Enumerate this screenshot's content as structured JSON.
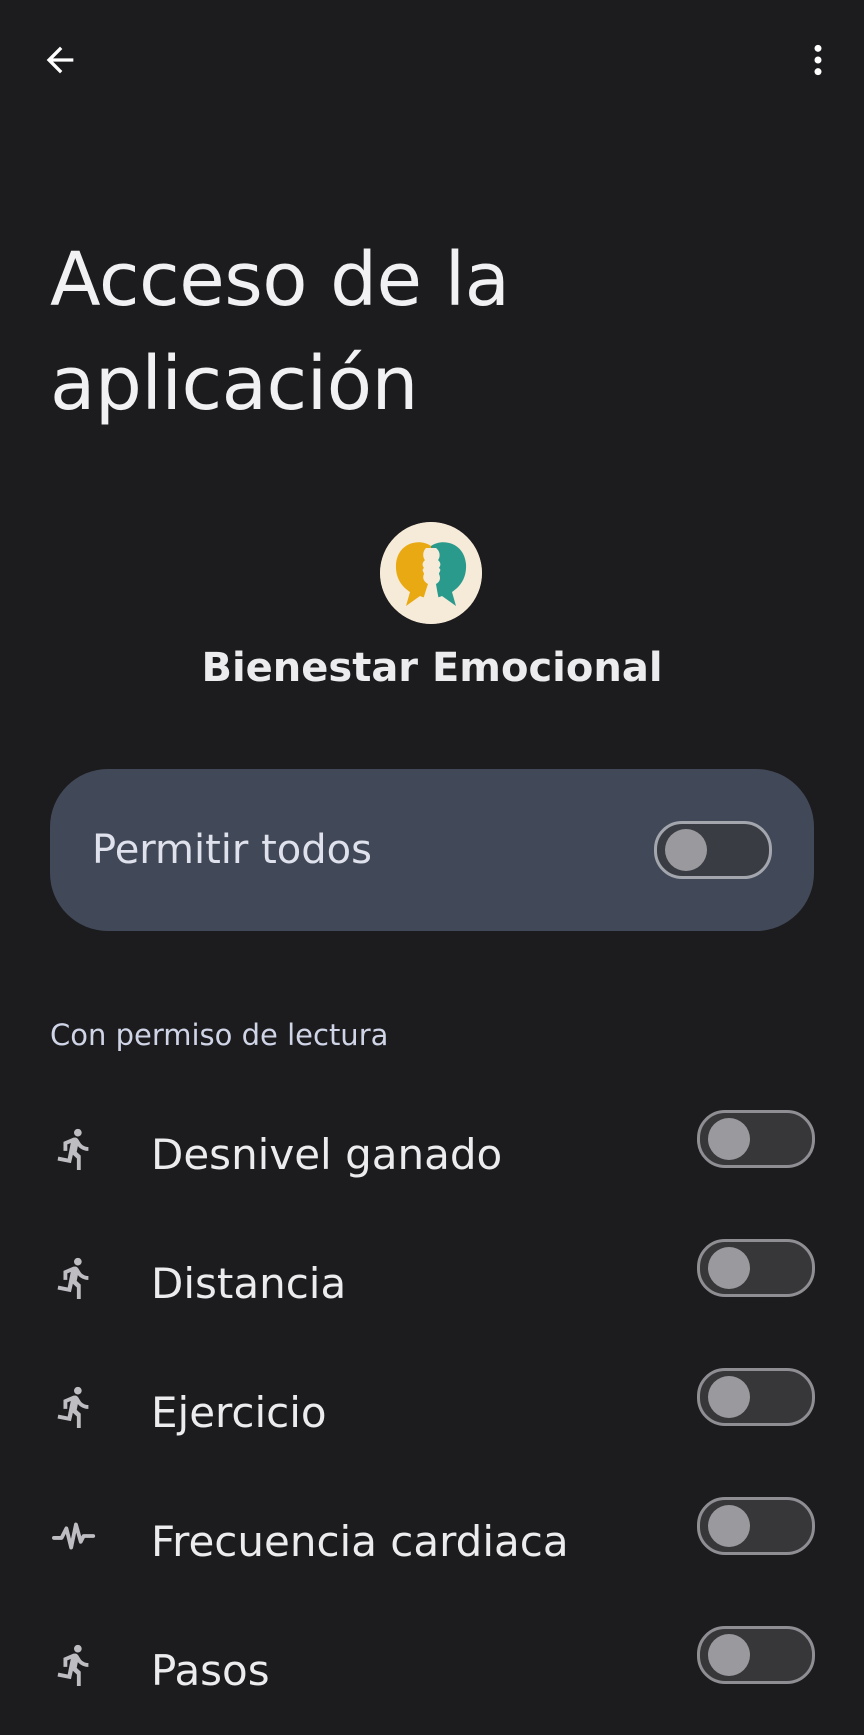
{
  "header": {
    "back_icon": "arrow-back-icon",
    "more_icon": "more-vert-icon",
    "title": "Acceso de la aplicación"
  },
  "app": {
    "name": "Bienestar Emocional",
    "icon": "two-faces-speech-bubble-logo",
    "icon_colors": [
      "#f6ead9",
      "#e9a912",
      "#2a9a8c"
    ]
  },
  "allow_all": {
    "label": "Permitir todos",
    "on": false
  },
  "section": {
    "label": "Con permiso de lectura"
  },
  "permissions": [
    {
      "label": "Desnivel ganado",
      "icon": "running-icon",
      "on": false
    },
    {
      "label": "Distancia",
      "icon": "running-icon",
      "on": false
    },
    {
      "label": "Ejercicio",
      "icon": "running-icon",
      "on": false
    },
    {
      "label": "Frecuencia cardiaca",
      "icon": "heart-rate-icon",
      "on": false
    },
    {
      "label": "Pasos",
      "icon": "running-icon",
      "on": false
    }
  ],
  "colors": {
    "background": "#1c1c1e",
    "card": "#414858",
    "text": "#ececee",
    "section_text": "#cfd4e6"
  }
}
